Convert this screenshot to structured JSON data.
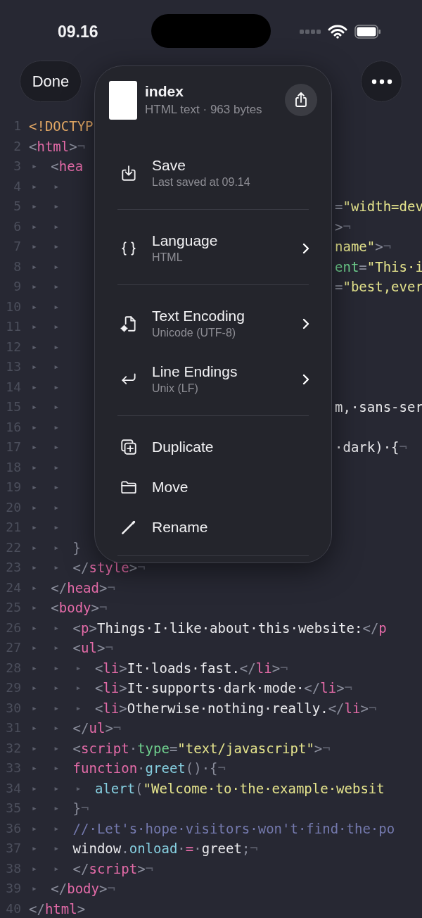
{
  "status_bar": {
    "time": "09.16"
  },
  "toolbar": {
    "done": "Done"
  },
  "editor": {
    "lines": [
      {
        "number": "1",
        "code": [
          {
            "kind": "doctype",
            "text": "<!DOCTYP"
          }
        ]
      },
      {
        "number": "2",
        "code": [
          {
            "kind": "punct",
            "text": "<"
          },
          {
            "kind": "tag",
            "text": "html"
          },
          {
            "kind": "punct",
            "text": ">"
          }
        ],
        "eol": "¬"
      },
      {
        "number": "3",
        "tabs": [
          "▸"
        ],
        "code": [
          {
            "kind": "punct",
            "text": "<"
          },
          {
            "kind": "tag",
            "text": "hea"
          }
        ]
      },
      {
        "number": "4",
        "tabs": [
          "▸",
          "▸"
        ]
      },
      {
        "number": "5",
        "tabs": [
          "▸",
          "▸"
        ],
        "right": [
          {
            "kind": "punct",
            "text": "="
          },
          {
            "kind": "string",
            "text": "\"width=dev"
          }
        ]
      },
      {
        "number": "6",
        "tabs": [
          "▸",
          "▸"
        ],
        "right": [
          {
            "kind": "punct",
            "text": ">"
          }
        ],
        "eol": "¬"
      },
      {
        "number": "7",
        "tabs": [
          "▸",
          "▸"
        ],
        "right": [
          {
            "kind": "string",
            "text": "name\""
          },
          {
            "kind": "punct",
            "text": ">"
          }
        ],
        "eol": "¬"
      },
      {
        "number": "8",
        "tabs": [
          "▸",
          "▸"
        ],
        "right": [
          {
            "kind": "attr",
            "text": "ent"
          },
          {
            "kind": "punct",
            "text": "="
          },
          {
            "kind": "string",
            "text": "\"This·i"
          }
        ]
      },
      {
        "number": "9",
        "tabs": [
          "▸",
          "▸"
        ],
        "right": [
          {
            "kind": "punct",
            "text": "="
          },
          {
            "kind": "string",
            "text": "\"best,ever"
          }
        ]
      },
      {
        "number": "10",
        "tabs": [
          "▸",
          "▸"
        ]
      },
      {
        "number": "11",
        "tabs": [
          "▸",
          "▸"
        ]
      },
      {
        "number": "12",
        "tabs": [
          "▸",
          "▸"
        ]
      },
      {
        "number": "13",
        "tabs": [
          "▸",
          "▸"
        ]
      },
      {
        "number": "14",
        "tabs": [
          "▸",
          "▸"
        ]
      },
      {
        "number": "15",
        "tabs": [
          "▸",
          "▸"
        ],
        "right": [
          {
            "kind": "plain",
            "text": "m,·sans-ser"
          }
        ]
      },
      {
        "number": "16",
        "tabs": [
          "▸",
          "▸"
        ]
      },
      {
        "number": "17",
        "tabs": [
          "▸",
          "▸"
        ],
        "right": [
          {
            "kind": "plain",
            "text": "·dark)·{"
          }
        ],
        "eol": "¬"
      },
      {
        "number": "18",
        "tabs": [
          "▸",
          "▸"
        ]
      },
      {
        "number": "19",
        "tabs": [
          "▸",
          "▸"
        ]
      },
      {
        "number": "20",
        "tabs": [
          "▸",
          "▸"
        ]
      },
      {
        "number": "21",
        "tabs": [
          "▸",
          "▸"
        ]
      },
      {
        "number": "22",
        "tabs": [
          "▸",
          "▸"
        ],
        "code": [
          {
            "kind": "punct",
            "text": "}"
          }
        ]
      },
      {
        "number": "23",
        "tabs": [
          "▸",
          "▸"
        ],
        "code": [
          {
            "kind": "punct",
            "text": "</"
          },
          {
            "kind": "tag",
            "text": "style"
          },
          {
            "kind": "punct",
            "text": ">"
          }
        ],
        "eol": "¬"
      },
      {
        "number": "24",
        "tabs": [
          "▸"
        ],
        "code": [
          {
            "kind": "punct",
            "text": "</"
          },
          {
            "kind": "tag",
            "text": "head"
          },
          {
            "kind": "punct",
            "text": ">"
          }
        ],
        "eol": "¬"
      },
      {
        "number": "25",
        "tabs": [
          "▸"
        ],
        "code": [
          {
            "kind": "punct",
            "text": "<"
          },
          {
            "kind": "tag",
            "text": "body"
          },
          {
            "kind": "punct",
            "text": ">"
          }
        ],
        "eol": "¬"
      },
      {
        "number": "26",
        "tabs": [
          "▸",
          "▸"
        ],
        "code": [
          {
            "kind": "punct",
            "text": "<"
          },
          {
            "kind": "tag",
            "text": "p"
          },
          {
            "kind": "punct",
            "text": ">"
          },
          {
            "kind": "plain",
            "text": "Things·I·like·about·this·website:"
          },
          {
            "kind": "punct",
            "text": "</"
          },
          {
            "kind": "tag",
            "text": "p"
          }
        ]
      },
      {
        "number": "27",
        "tabs": [
          "▸",
          "▸"
        ],
        "code": [
          {
            "kind": "punct",
            "text": "<"
          },
          {
            "kind": "tag",
            "text": "ul"
          },
          {
            "kind": "punct",
            "text": ">"
          }
        ],
        "eol": "¬"
      },
      {
        "number": "28",
        "tabs": [
          "▸",
          "▸",
          "▸"
        ],
        "code": [
          {
            "kind": "punct",
            "text": "<"
          },
          {
            "kind": "tag",
            "text": "li"
          },
          {
            "kind": "punct",
            "text": ">"
          },
          {
            "kind": "plain",
            "text": "It·loads·fast."
          },
          {
            "kind": "punct",
            "text": "</"
          },
          {
            "kind": "tag",
            "text": "li"
          },
          {
            "kind": "punct",
            "text": ">"
          }
        ],
        "eol": "¬"
      },
      {
        "number": "29",
        "tabs": [
          "▸",
          "▸",
          "▸"
        ],
        "code": [
          {
            "kind": "punct",
            "text": "<"
          },
          {
            "kind": "tag",
            "text": "li"
          },
          {
            "kind": "punct",
            "text": ">"
          },
          {
            "kind": "plain",
            "text": "It·supports·dark·mode·"
          },
          {
            "kind": "punct",
            "text": "</"
          },
          {
            "kind": "tag",
            "text": "li"
          },
          {
            "kind": "punct",
            "text": ">"
          }
        ],
        "eol": "¬"
      },
      {
        "number": "30",
        "tabs": [
          "▸",
          "▸",
          "▸"
        ],
        "code": [
          {
            "kind": "punct",
            "text": "<"
          },
          {
            "kind": "tag",
            "text": "li"
          },
          {
            "kind": "punct",
            "text": ">"
          },
          {
            "kind": "plain",
            "text": "Otherwise·nothing·really."
          },
          {
            "kind": "punct",
            "text": "</"
          },
          {
            "kind": "tag",
            "text": "li"
          },
          {
            "kind": "punct",
            "text": ">"
          }
        ],
        "eol": "¬"
      },
      {
        "number": "31",
        "tabs": [
          "▸",
          "▸"
        ],
        "code": [
          {
            "kind": "punct",
            "text": "</"
          },
          {
            "kind": "tag",
            "text": "ul"
          },
          {
            "kind": "punct",
            "text": ">"
          }
        ],
        "eol": "¬"
      },
      {
        "number": "32",
        "tabs": [
          "▸",
          "▸"
        ],
        "code": [
          {
            "kind": "punct",
            "text": "<"
          },
          {
            "kind": "tag",
            "text": "script"
          },
          {
            "kind": "punct",
            "text": "·"
          },
          {
            "kind": "attr",
            "text": "type"
          },
          {
            "kind": "punct",
            "text": "="
          },
          {
            "kind": "string",
            "text": "\"text/javascript\""
          },
          {
            "kind": "punct",
            "text": ">"
          }
        ],
        "eol": "¬"
      },
      {
        "number": "33",
        "tabs": [
          "▸",
          "▸"
        ],
        "code": [
          {
            "kind": "keyword",
            "text": "function"
          },
          {
            "kind": "punct",
            "text": "·"
          },
          {
            "kind": "func",
            "text": "greet"
          },
          {
            "kind": "punct",
            "text": "()·{"
          }
        ],
        "eol": "¬"
      },
      {
        "number": "34",
        "tabs": [
          "▸",
          "▸",
          "▸"
        ],
        "code": [
          {
            "kind": "func",
            "text": "alert"
          },
          {
            "kind": "punct",
            "text": "("
          },
          {
            "kind": "string",
            "text": "\"Welcome·to·the·example·websit"
          }
        ]
      },
      {
        "number": "35",
        "tabs": [
          "▸",
          "▸"
        ],
        "code": [
          {
            "kind": "punct",
            "text": "}"
          }
        ],
        "eol": "¬"
      },
      {
        "number": "36",
        "tabs": [
          "▸",
          "▸"
        ],
        "code": [
          {
            "kind": "comment",
            "text": "//·Let's·hope·visitors·won't·find·the·po"
          }
        ]
      },
      {
        "number": "37",
        "tabs": [
          "▸",
          "▸"
        ],
        "code": [
          {
            "kind": "plain",
            "text": "window"
          },
          {
            "kind": "punct",
            "text": "."
          },
          {
            "kind": "func",
            "text": "onload"
          },
          {
            "kind": "punct",
            "text": "·"
          },
          {
            "kind": "keyword",
            "text": "="
          },
          {
            "kind": "punct",
            "text": "·"
          },
          {
            "kind": "plain",
            "text": "greet"
          },
          {
            "kind": "punct",
            "text": ";"
          }
        ],
        "eol": "¬"
      },
      {
        "number": "38",
        "tabs": [
          "▸",
          "▸"
        ],
        "code": [
          {
            "kind": "punct",
            "text": "</"
          },
          {
            "kind": "tag",
            "text": "script"
          },
          {
            "kind": "punct",
            "text": ">"
          }
        ],
        "eol": "¬"
      },
      {
        "number": "39",
        "tabs": [
          "▸"
        ],
        "code": [
          {
            "kind": "punct",
            "text": "</"
          },
          {
            "kind": "tag",
            "text": "body"
          },
          {
            "kind": "punct",
            "text": ">"
          }
        ],
        "eol": "¬"
      },
      {
        "number": "40",
        "code": [
          {
            "kind": "punct",
            "text": "</"
          },
          {
            "kind": "tag",
            "text": "html"
          },
          {
            "kind": "punct",
            "text": ">"
          }
        ]
      }
    ]
  },
  "menu": {
    "file": {
      "name": "index",
      "info": "HTML text · 963 bytes"
    },
    "groups": [
      {
        "items": [
          {
            "title": "Save",
            "subtitle": "Last saved at 09.14",
            "submenu": false
          }
        ]
      },
      {
        "items": [
          {
            "title": "Language",
            "subtitle": "HTML",
            "submenu": true
          }
        ]
      },
      {
        "items": [
          {
            "title": "Text Encoding",
            "subtitle": "Unicode (UTF-8)",
            "submenu": true
          },
          {
            "title": "Line Endings",
            "subtitle": "Unix (LF)",
            "submenu": true
          }
        ]
      },
      {
        "items": [
          {
            "title": "Duplicate",
            "submenu": false
          },
          {
            "title": "Move",
            "submenu": false
          },
          {
            "title": "Rename",
            "submenu": false
          }
        ]
      }
    ]
  }
}
